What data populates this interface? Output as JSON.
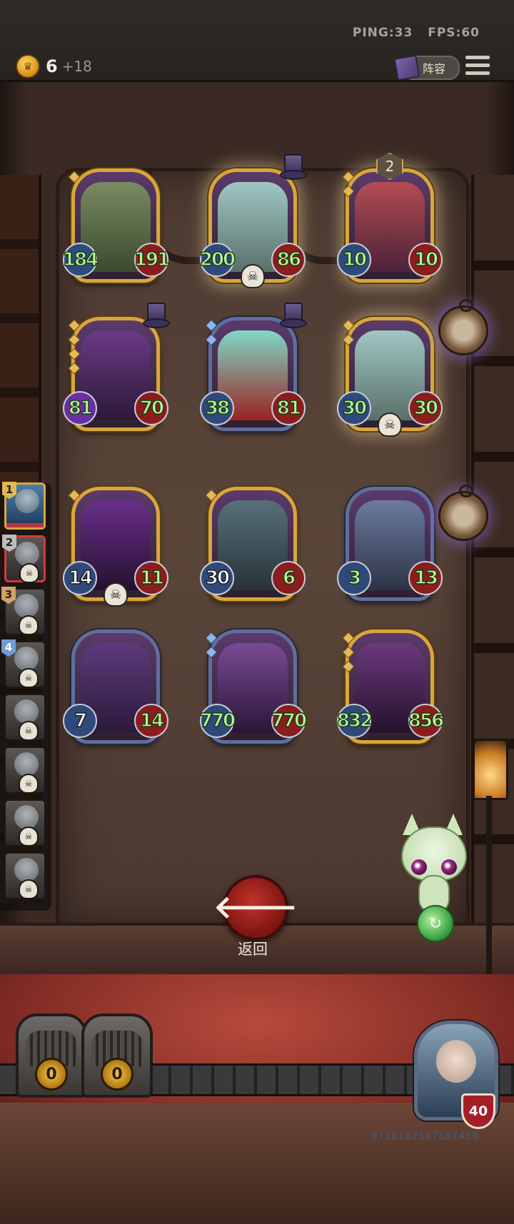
{
  "header": {
    "ping_label": "PING:33",
    "fps_label": "FPS:60",
    "gold": "6",
    "gold_income": "+18",
    "lineup_label": "阵容"
  },
  "cards": [
    {
      "name": "purple-dragon",
      "atk": "184",
      "hp": "191",
      "frame": "gold",
      "pips": 1
    },
    {
      "name": "skull-spider-golem",
      "atk": "200",
      "hp": "86",
      "frame": "gold",
      "pips": 0,
      "skull": true,
      "hat": true
    },
    {
      "name": "clown-jester",
      "atk": "10",
      "hp": "10",
      "frame": "gold",
      "pips": 2,
      "tier": "2"
    },
    {
      "name": "hooded-skull-mage",
      "atk": "81",
      "hp": "70",
      "frame": "gold",
      "pips": 4,
      "hat": true
    },
    {
      "name": "ghost-vampire",
      "atk": "38",
      "hp": "81",
      "frame": "silver",
      "pips": 2,
      "hat": true
    },
    {
      "name": "skull-spider-golem-2",
      "atk": "30",
      "hp": "30",
      "frame": "gold",
      "pips": 2,
      "skull": true
    },
    {
      "name": "tentacle-shadow",
      "atk": "14",
      "hp": "11",
      "frame": "gold",
      "pips": 1,
      "skull": true
    },
    {
      "name": "blade-warrior",
      "atk": "30",
      "hp": "6",
      "frame": "gold",
      "pips": 1
    },
    {
      "name": "winged-demon",
      "atk": "3",
      "hp": "13",
      "frame": "silver",
      "pips": 0
    },
    {
      "name": "redhead-elf",
      "atk": "7",
      "hp": "14",
      "frame": "silver",
      "pips": 0
    },
    {
      "name": "pumpkin-monster",
      "atk": "770",
      "hp": "770",
      "frame": "silver",
      "pips": 2
    },
    {
      "name": "tiki-totem",
      "atk": "832",
      "hp": "856",
      "frame": "gold",
      "pips": 3
    }
  ],
  "roster": [
    {
      "num": "1"
    },
    {
      "num": "2"
    },
    {
      "num": "3"
    },
    {
      "num": "4"
    },
    {
      "num": ""
    },
    {
      "num": ""
    },
    {
      "num": ""
    },
    {
      "num": ""
    }
  ],
  "back_label": "返回",
  "chests": {
    "left": "0",
    "right": "0"
  },
  "hero_hp": "40",
  "build_id": "0718102567587456",
  "colors": {
    "gold_frame": "#d9a63a",
    "silver_frame": "#5f6f9a",
    "stat_text": "#b9f29a",
    "back_button": "#c0342b"
  }
}
